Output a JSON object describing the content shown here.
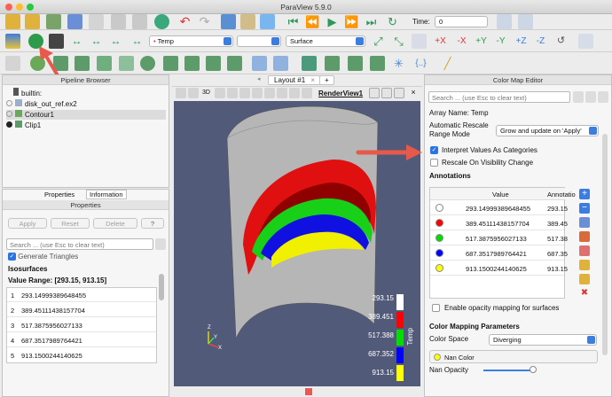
{
  "window": {
    "title": "ParaView 5.9.0"
  },
  "toolbar": {
    "time_label": "Time:",
    "time_value": "0",
    "array_selector": "Temp",
    "representation": "Surface"
  },
  "pipeline_browser": {
    "title": "Pipeline Browser",
    "items": [
      {
        "label": "builtin:"
      },
      {
        "label": "disk_out_ref.ex2"
      },
      {
        "label": "Contour1"
      },
      {
        "label": "Clip1"
      }
    ]
  },
  "properties": {
    "tabs": [
      "Properties",
      "Information"
    ],
    "title": "Properties",
    "apply_label": "Apply",
    "reset_label": "Reset",
    "delete_label": "Delete",
    "help_label": "?",
    "search_placeholder": "Search ... (use Esc to clear text)",
    "generate_triangles_label": "Generate Triangles",
    "isosurfaces_label": "Isosurfaces",
    "value_range": "Value Range: [293.15, 913.15]",
    "isovalues": [
      {
        "index": "1",
        "value": "293.14999389648455"
      },
      {
        "index": "2",
        "value": "389.45111438157704"
      },
      {
        "index": "3",
        "value": "517.3875956027133"
      },
      {
        "index": "4",
        "value": "687.3517989764421"
      },
      {
        "index": "5",
        "value": "913.1500244140625"
      }
    ]
  },
  "layout": {
    "tab_label": "Layout #1",
    "add_tab": "+",
    "view_label": "RenderView1",
    "btn_3d": "3D"
  },
  "scalar_bar": {
    "title": "Temp",
    "labels": [
      "293.15",
      "389.451",
      "517.388",
      "687.352",
      "913.15"
    ],
    "colors": [
      "#ffffff",
      "#ff0000",
      "#00dd00",
      "#0000ff",
      "#ffff00"
    ]
  },
  "axes": {
    "x": "X",
    "y": "Y",
    "z": "Z"
  },
  "color_map_editor": {
    "title": "Color Map Editor",
    "search_placeholder": "Search ... (use Esc to clear text)",
    "array_name": "Array Name: Temp",
    "rescale_label": "Automatic Rescale Range Mode",
    "rescale_value": "Grow and update on 'Apply'",
    "interpret_categories_label": "Interpret Values As Categories",
    "rescale_visibility_label": "Rescale On Visibility Change",
    "annotations_label": "Annotations",
    "table_headers": [
      "Value",
      "Annotatio"
    ],
    "annotations": [
      {
        "value": "293.14999389648455",
        "annotation": "293.15",
        "color": "#ffffff"
      },
      {
        "value": "389.451114381577​04",
        "annotation": "389.45",
        "color": "#ff0000"
      },
      {
        "value": "517.3875956027133",
        "annotation": "517.38",
        "color": "#00dd00"
      },
      {
        "value": "687.3517989764421",
        "annotation": "687.35",
        "color": "#0000ff"
      },
      {
        "value": "913.1500244140625",
        "annotation": "913.15",
        "color": "#ffff00"
      }
    ],
    "opacity_label": "Enable opacity mapping for surfaces",
    "mapping_params_label": "Color Mapping Parameters",
    "color_space_label": "Color Space",
    "color_space_value": "Diverging",
    "nan_color_label": "Nan Color",
    "nan_opacity_label": "Nan Opacity"
  },
  "colors": {
    "accent": "#3d7de0",
    "arrow": "#e8594a",
    "render_bg": "#525a7a"
  }
}
